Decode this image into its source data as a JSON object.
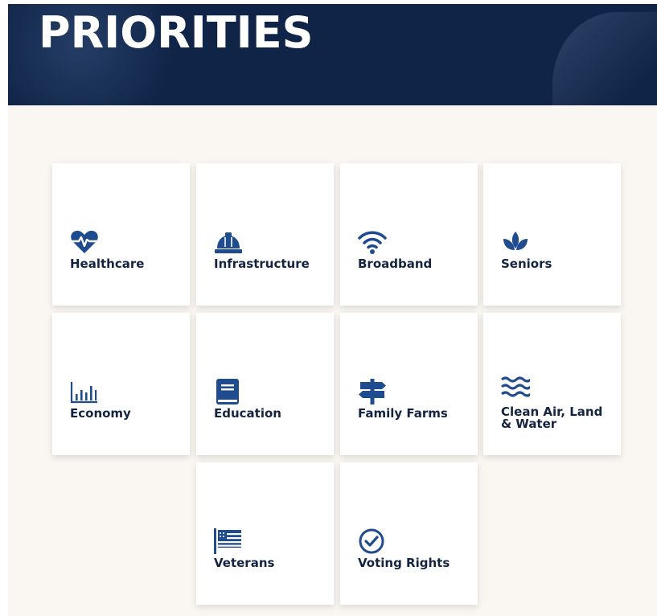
{
  "hero": {
    "title": "PRIORITIES"
  },
  "tiles": [
    {
      "label": "Healthcare",
      "icon": "heart-pulse-icon"
    },
    {
      "label": "Infrastructure",
      "icon": "hard-hat-icon"
    },
    {
      "label": "Broadband",
      "icon": "wifi-icon"
    },
    {
      "label": "Seniors",
      "icon": "lotus-icon"
    },
    {
      "label": "Economy",
      "icon": "bar-chart-icon"
    },
    {
      "label": "Education",
      "icon": "book-icon"
    },
    {
      "label": "Family Farms",
      "icon": "signpost-icon"
    },
    {
      "label": "Clean Air, Land & Water",
      "icon": "waves-icon"
    },
    {
      "label": "Veterans",
      "icon": "flag-icon"
    },
    {
      "label": "Voting Rights",
      "icon": "check-circle-icon"
    }
  ],
  "colors": {
    "hero_bg": "#0f2447",
    "content_bg": "#faf7f2",
    "icon": "#1f4b8f",
    "label": "#142340"
  }
}
